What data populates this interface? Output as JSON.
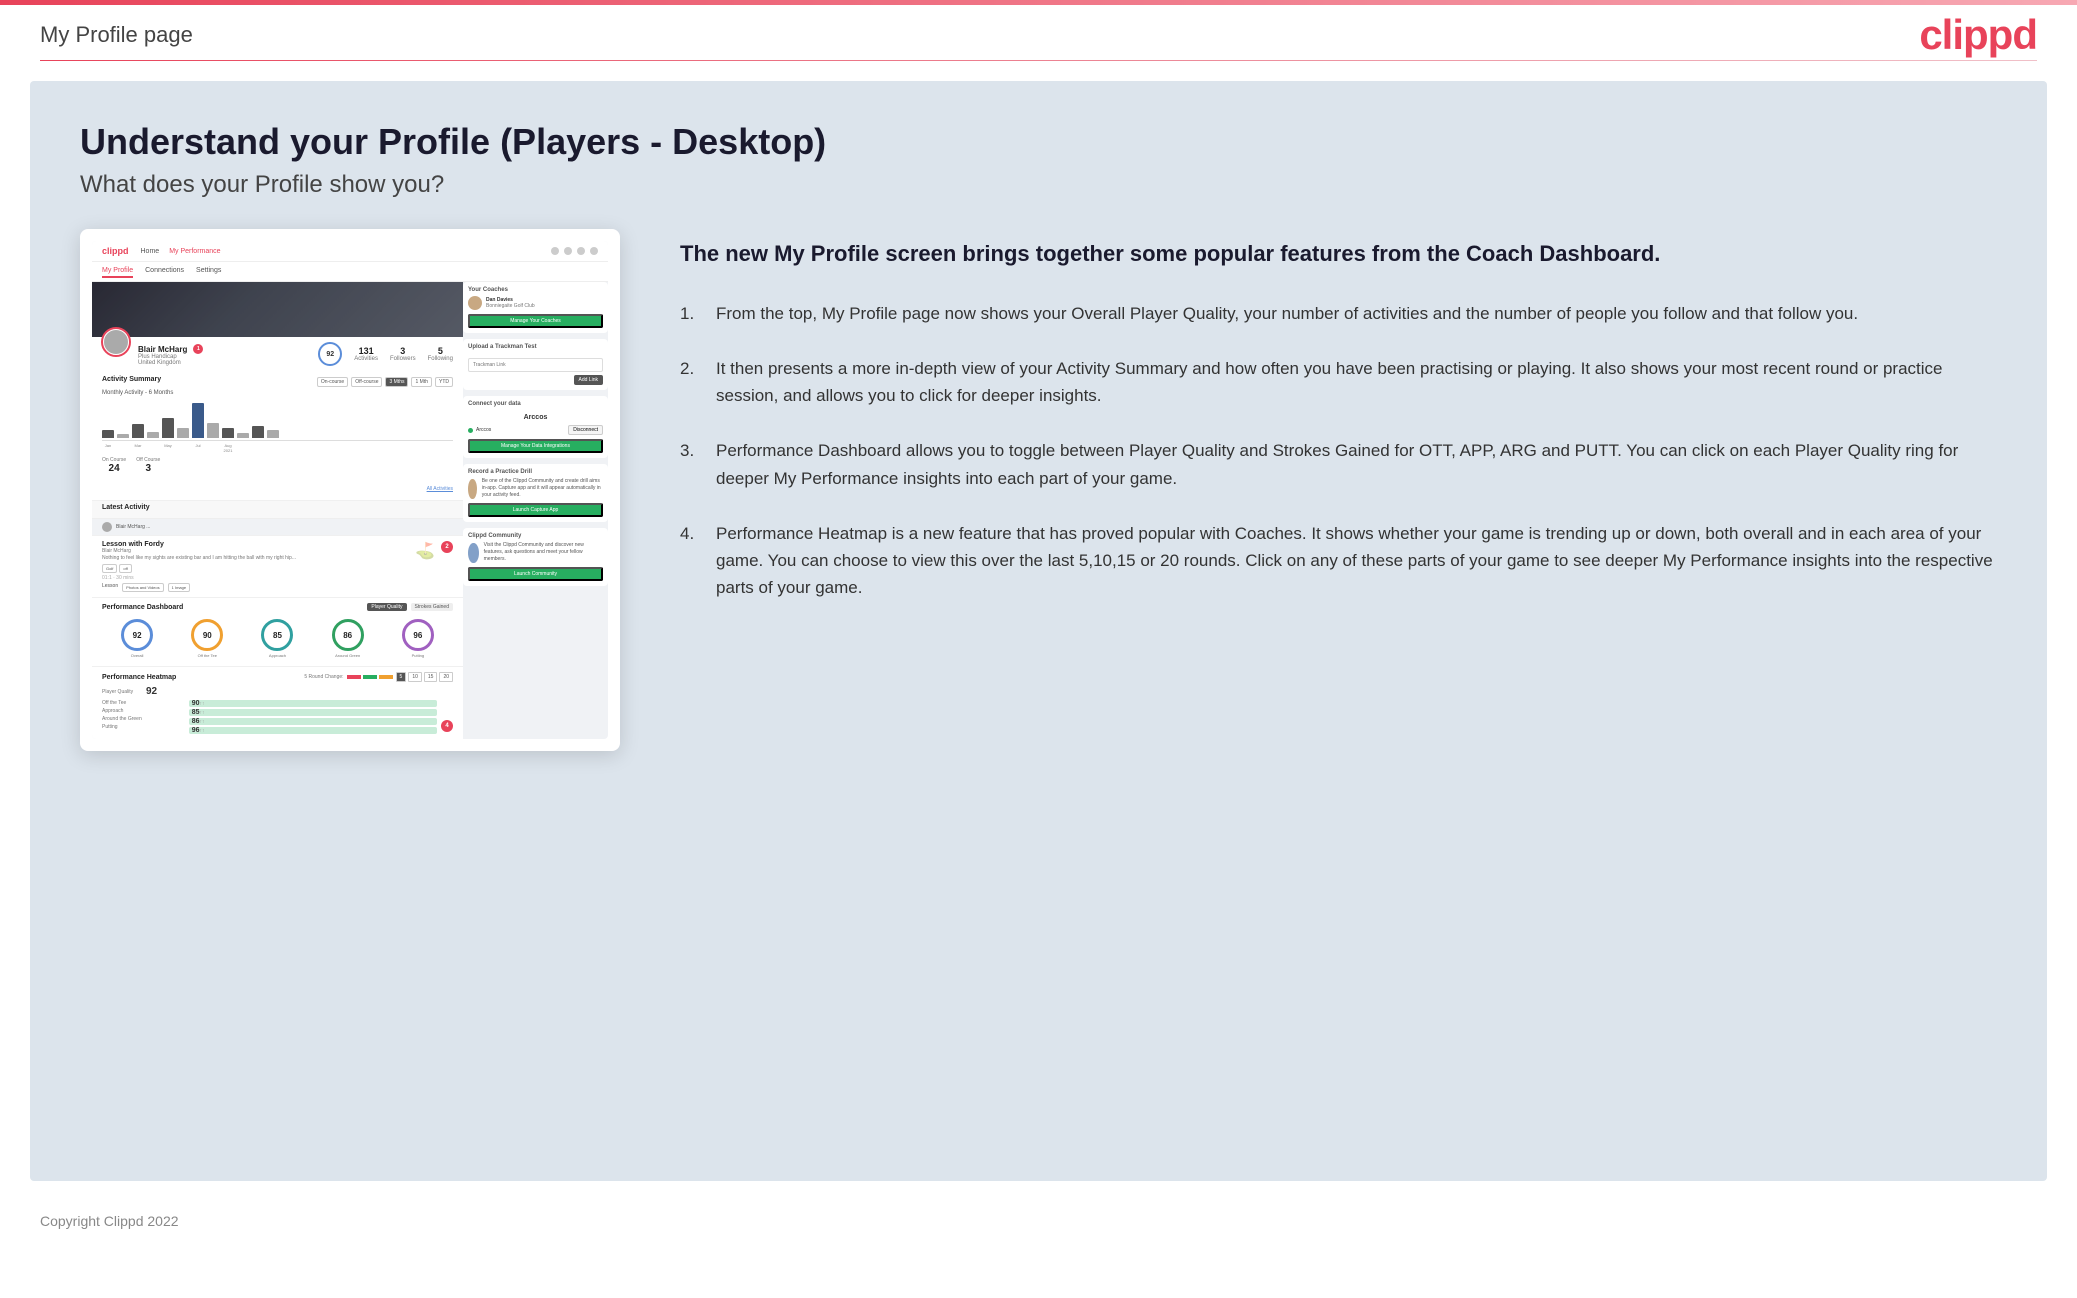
{
  "header": {
    "page_title": "My Profile page",
    "logo_text": "clippd"
  },
  "main": {
    "heading": "Understand your Profile (Players - Desktop)",
    "subheading": "What does your Profile show you?",
    "intro_bold": "The new My Profile screen brings together some popular features from the Coach Dashboard.",
    "list_items": [
      "From the top, My Profile page now shows your Overall Player Quality, your number of activities and the number of people you follow and that follow you.",
      "It then presents a more in-depth view of your Activity Summary and how often you have been practising or playing. It also shows your most recent round or practice session, and allows you to click for deeper insights.",
      "Performance Dashboard allows you to toggle between Player Quality and Strokes Gained for OTT, APP, ARG and PUTT. You can click on each Player Quality ring for deeper My Performance insights into each part of your game.",
      "Performance Heatmap is a new feature that has proved popular with Coaches. It shows whether your game is trending up or down, both overall and in each area of your game. You can choose to view this over the last 5,10,15 or 20 rounds. Click on any of these parts of your game to see deeper My Performance insights into the respective parts of your game."
    ]
  },
  "mockup": {
    "nav_logo": "clippd",
    "nav_links": [
      "Home",
      "My Performance"
    ],
    "tabs": [
      "My Profile",
      "Connections",
      "Settings"
    ],
    "profile": {
      "name": "Blair McHarg",
      "handicap": "Plus Handicap",
      "country": "United Kingdom",
      "quality": "92",
      "activities": "131",
      "followers": "3",
      "following": "5"
    },
    "activity": {
      "title": "Activity Summary",
      "period": "Monthly Activity - 6 Months",
      "on_course": "24",
      "off_course": "3"
    },
    "coaches": {
      "title": "Your Coaches",
      "coach_name": "Dan Davies",
      "coach_club": "Bonniegaite Golf Club",
      "button": "Manage Your Coaches"
    },
    "trackman": {
      "title": "Upload a Trackman Test",
      "placeholder": "Trackman Link",
      "add_btn": "Add Link"
    },
    "connect": {
      "title": "Connect your data",
      "app_name": "Arccos",
      "button": "Manage Your Data Integrations"
    },
    "drill": {
      "title": "Record a Practice Drill",
      "button": "Launch Capture App"
    },
    "community": {
      "title": "Clippd Community",
      "button": "Launch Community"
    },
    "performance": {
      "title": "Performance Dashboard",
      "toggle1": "Player Quality",
      "toggle2": "Strokes Gained",
      "rings": [
        {
          "value": "92",
          "label": "Overall",
          "color": "blue"
        },
        {
          "value": "90",
          "label": "Off the Tee",
          "color": "orange"
        },
        {
          "value": "85",
          "label": "Approach",
          "color": "teal"
        },
        {
          "value": "86",
          "label": "Around the Green",
          "color": "green"
        },
        {
          "value": "96",
          "label": "Putting",
          "color": "purple"
        }
      ]
    },
    "heatmap": {
      "title": "Performance Heatmap",
      "change_label": "5 Round Change:",
      "rounds": [
        "5",
        "10",
        "15",
        "20"
      ],
      "rows": [
        {
          "label": "Player Quality",
          "value": "92"
        },
        {
          "label": "Off the Tee",
          "value": "90",
          "cell": "90 ↑↑"
        },
        {
          "label": "Approach",
          "value": "85",
          "cell": "85 ↑↑"
        },
        {
          "label": "Around the Green",
          "value": "86",
          "cell": "86 ↑↑"
        },
        {
          "label": "Putting",
          "value": "96",
          "cell": "96 ↑↑"
        }
      ]
    },
    "lesson": {
      "title": "Lesson with Fordy",
      "coach": "Blair McHarg",
      "text": "Nothing to feel like my sights are existing...",
      "tags": [
        "Grit",
        "off"
      ],
      "date": "01:1 · 30 mins",
      "media": "0 Photos and Videos",
      "images": "1 Image"
    },
    "latest_activity": {
      "title": "Latest Activity",
      "user": "Blair McHarg",
      "info": "..."
    }
  },
  "footer": {
    "copyright": "Copyright Clippd 2022"
  }
}
